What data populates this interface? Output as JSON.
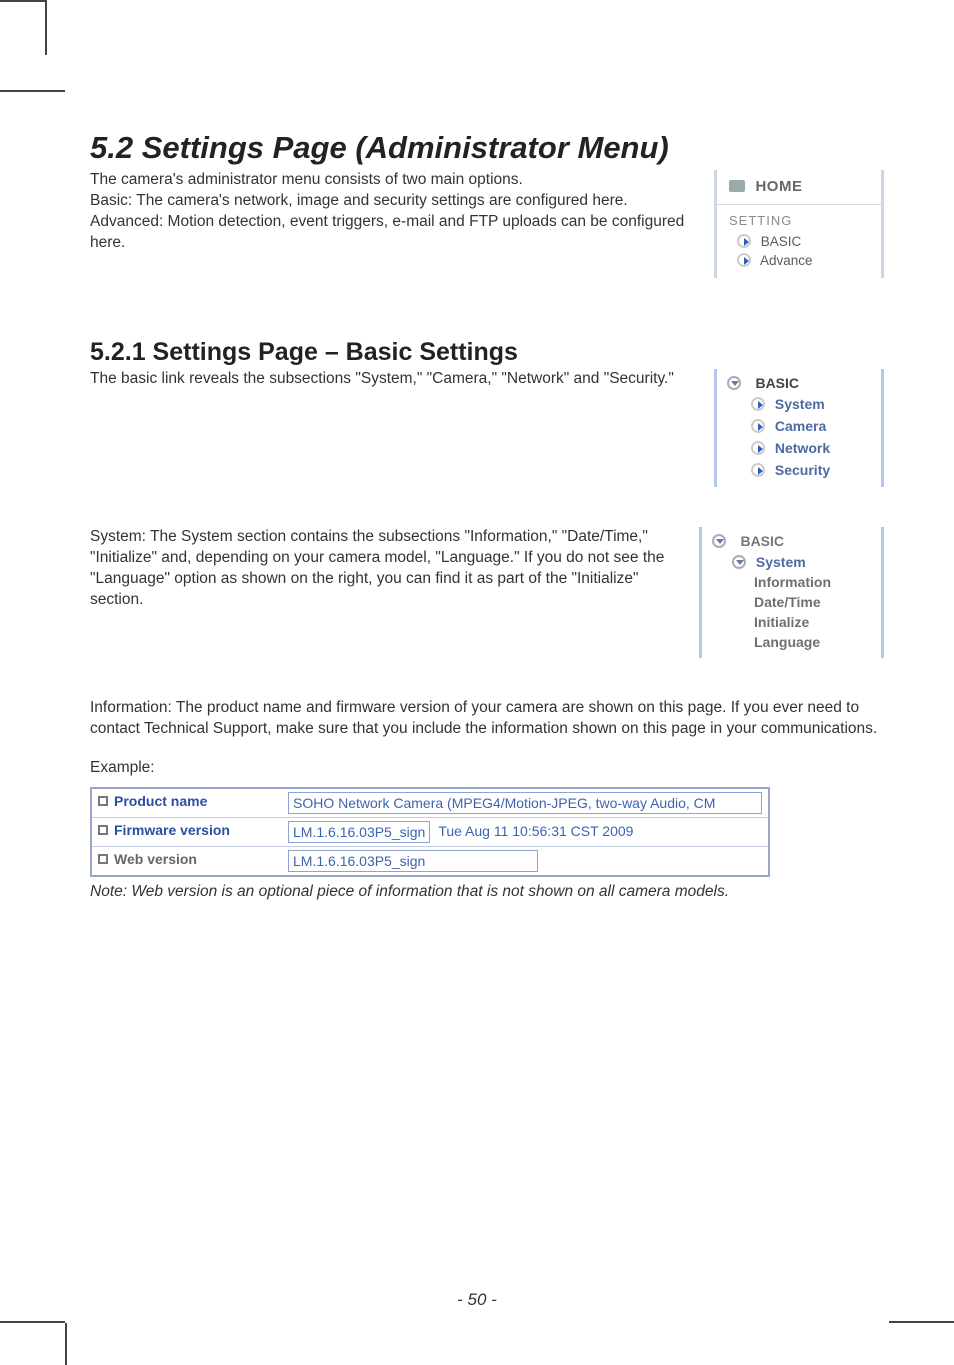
{
  "headings": {
    "h1": "5.2 Settings Page (Administrator Menu)",
    "h2": "5.2.1 Settings Page – Basic Settings"
  },
  "para": {
    "intro1": "The camera's administrator menu consists of two main options.",
    "intro2": "Basic: The camera's network, image and security settings are configured here.",
    "intro3": "Advanced: Motion detection, event triggers, e-mail and FTP uploads can be configured here.",
    "basic_intro": "The basic link reveals the subsections \"System,\" \"Camera,\" \"Network\" and \"Security.\"",
    "system_para": "System: The System section contains the subsections \"Information,\" \"Date/Time,\" \"Initialize\" and, depending on your camera model, \"Language.\" If you do not see the \"Language\" option as shown on the right, you can find it as part of the \"Initialize\" section.",
    "info_para": "Information: The product name and firmware version of your camera are shown on this page. If you ever need to contact Technical Support, make sure that you include the information shown on this page in your communications.",
    "example_label": "Example:",
    "note": "Note: Web version is an optional piece of information that is not shown on all camera models."
  },
  "menu_a": {
    "home": "HOME",
    "setting": "SETTING",
    "basic": "BASIC",
    "advance": "Advance"
  },
  "menu_b": {
    "head": "BASIC",
    "system": "System",
    "camera": "Camera",
    "network": "Network",
    "security": "Security"
  },
  "menu_c": {
    "head": "BASIC",
    "system": "System",
    "information": "Information",
    "datetime": "Date/Time",
    "initialize": "Initialize",
    "language": "Language"
  },
  "table": {
    "product_name_label": "Product name",
    "product_name_value": "SOHO Network Camera (MPEG4/Motion-JPEG, two-way Audio, CM",
    "firmware_label": "Firmware version",
    "firmware_value1": "LM.1.6.16.03P5_sign",
    "firmware_value2": "Tue Aug 11 10:56:31 CST 2009",
    "web_label": "Web version",
    "web_value": "LM.1.6.16.03P5_sign"
  },
  "pagenum": "- 50 -"
}
